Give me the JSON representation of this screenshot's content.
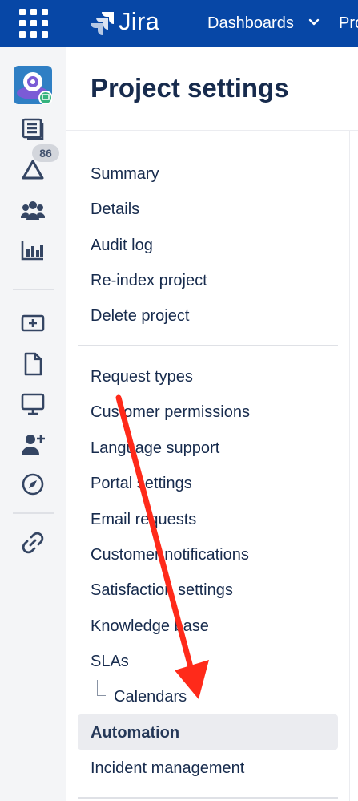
{
  "topbar": {
    "product_name": "Jira",
    "nav_dashboards": "Dashboards",
    "nav_projects_partial": "Pro"
  },
  "rail": {
    "notifications_count": "86",
    "icons": [
      "project-avatar",
      "board-icon",
      "alert-icon",
      "people-icon",
      "reports-icon",
      "add-queue-icon",
      "document-icon",
      "monitor-icon",
      "add-user-icon",
      "compass-icon",
      "link-icon"
    ]
  },
  "main": {
    "title": "Project settings",
    "section1": [
      "Summary",
      "Details",
      "Audit log",
      "Re-index project",
      "Delete project"
    ],
    "section2": [
      "Request types",
      "Customer permissions",
      "Language support",
      "Portal settings",
      "Email requests",
      "Customer notifications",
      "Satisfaction settings",
      "Knowledge base",
      "SLAs"
    ],
    "sub_item": "Calendars",
    "selected_item": "Automation",
    "last_item": "Incident management"
  },
  "colors": {
    "topbar": "#0747a6",
    "rail": "#f4f5f7",
    "text": "#172b4d",
    "selected_bg": "#ebecf0",
    "annotation_arrow": "#ff2a1a"
  }
}
